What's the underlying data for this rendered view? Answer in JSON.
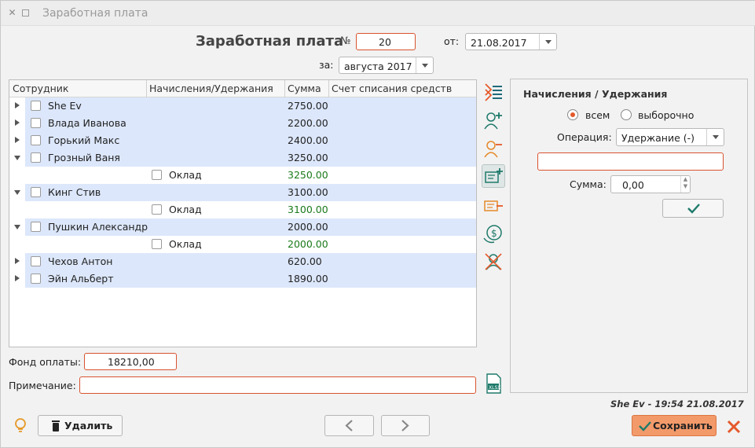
{
  "window": {
    "title": "Заработная плата"
  },
  "header": {
    "title": "Заработная плата",
    "number_label": "№",
    "number_value": "20",
    "date_label": "от:",
    "date_value": "21.08.2017",
    "period_label": "за:",
    "period_value": "августа 2017"
  },
  "table": {
    "columns": [
      "Сотрудник",
      "Начисления/Удержания",
      "Сумма",
      "Счет списания средств"
    ],
    "rows": [
      {
        "name": "She Ev",
        "sum": "2750.00"
      },
      {
        "name": "Влада Иванова",
        "sum": "2200.00"
      },
      {
        "name": "Горький Макс",
        "sum": "2400.00"
      },
      {
        "name": "Грозный Ваня",
        "sum": "3250.00"
      },
      {
        "item": "Оклад",
        "sum": "3250.00"
      },
      {
        "name": "Кинг Стив",
        "sum": "3100.00"
      },
      {
        "item": "Оклад",
        "sum": "3100.00"
      },
      {
        "name": "Пушкин Александр",
        "sum": "2000.00"
      },
      {
        "item": "Оклад",
        "sum": "2000.00"
      },
      {
        "name": "Чехов Антон",
        "sum": "620.00"
      },
      {
        "name": "Эйн Альберт",
        "sum": "1890.00"
      }
    ]
  },
  "footer": {
    "fund_label": "Фонд оплаты:",
    "fund_value": "18210,00",
    "note_label": "Примечание:",
    "note_value": "",
    "status": "She Ev - 19:54 21.08.2017",
    "delete_label": "Удалить",
    "save_label": "Сохранить"
  },
  "panel": {
    "title": "Начисления / Удержания",
    "radio_all": "всем",
    "radio_select": "выборочно",
    "operation_label": "Операция:",
    "operation_value": "Удержание (-)",
    "sum_label": "Сумма:",
    "sum_value": "0,00"
  },
  "colors": {
    "accent": "#e5592a",
    "row_highlight": "#dce7fb",
    "green_sum": "#1a7a1a",
    "icon_teal": "#1e7a6a"
  }
}
